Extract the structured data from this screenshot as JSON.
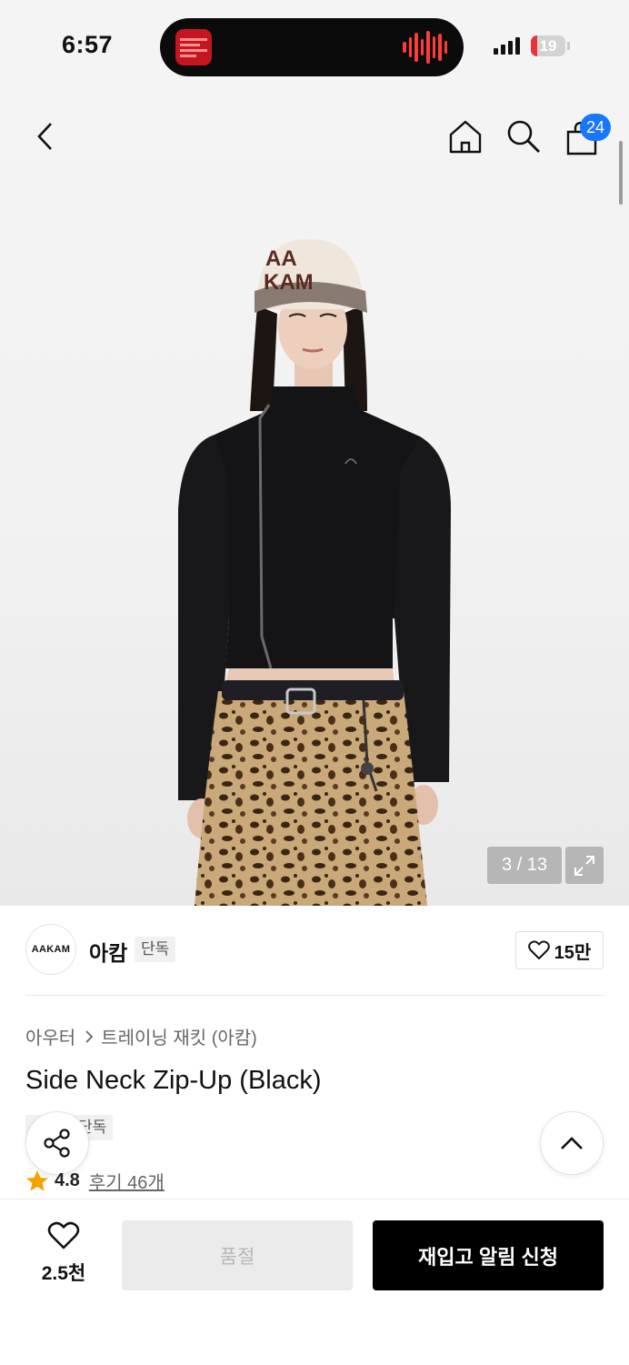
{
  "status_bar": {
    "time": "6:57",
    "battery": "19",
    "battery_level": 0.19
  },
  "header": {
    "cart_count": "24",
    "icons": [
      "back-arrow-icon",
      "home-icon",
      "search-icon",
      "shopping-bag-icon"
    ]
  },
  "gallery": {
    "counter": "3 / 13",
    "cap_text_line1": "AA",
    "cap_text_line2": "KAM"
  },
  "brand": {
    "logo_text": "AAKAM",
    "name": "아캄",
    "badge": "단독",
    "likes": "15만"
  },
  "breadcrumb": {
    "category": "아우터",
    "subcategory": "트레이닝 재킷 (아캄)"
  },
  "product": {
    "title": "Side Neck Zip-Up (Black)",
    "tag": "단독"
  },
  "rating": {
    "score": "4.8",
    "reviews": "후기 46개"
  },
  "bottom_bar": {
    "wish_count": "2.5천",
    "soldout_label": "품절",
    "restock_label": "재입고 알림 신청"
  },
  "colors": {
    "accent": "#1877ff",
    "star": "#f5a100",
    "battery_low": "#e8333a"
  }
}
